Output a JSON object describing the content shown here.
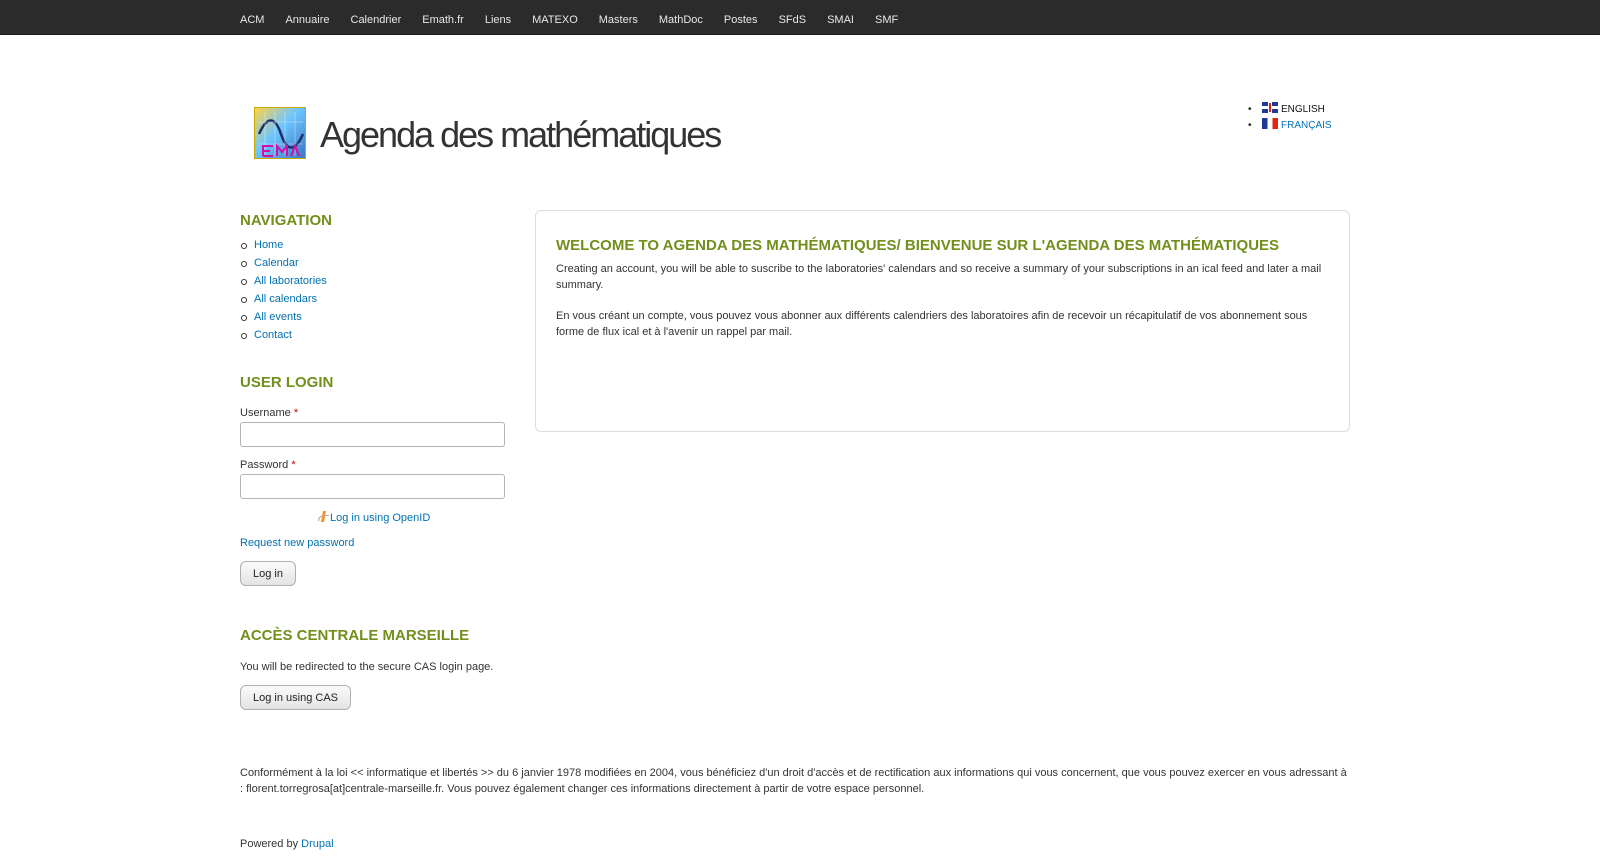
{
  "topnav": [
    "ACM",
    "Annuaire",
    "Calendrier",
    "Emath.fr",
    "Liens",
    "MATEXO",
    "Masters",
    "MathDoc",
    "Postes",
    "SFdS",
    "SMAI",
    "SMF"
  ],
  "header": {
    "site_name": "Agenda des mathématiques",
    "logo_icon": "emath-logo-icon",
    "languages": [
      {
        "label": "English",
        "flag": "uk-flag-icon",
        "active": true
      },
      {
        "label": "Français",
        "flag": "fr-flag-icon",
        "active": false
      }
    ]
  },
  "sidebar": {
    "navigation": {
      "title": "Navigation",
      "items": [
        "Home",
        "Calendar",
        "All laboratories",
        "All calendars",
        "All events",
        "Contact"
      ]
    },
    "user_login": {
      "title": "User login",
      "username_label": "Username",
      "password_label": "Password",
      "required_mark": "*",
      "username_value": "",
      "password_value": "",
      "openid_link": "Log in using OpenID",
      "request_password": "Request new password",
      "login_button": "Log in"
    },
    "cas": {
      "title": "Accès Centrale Marseille",
      "text": "You will be redirected to the secure CAS login page.",
      "button": "Log in using CAS"
    }
  },
  "content": {
    "title": "Welcome to Agenda des mathématiques/ Bienvenue sur l'Agenda des mathématiques",
    "p1": "Creating an account, you will be able to suscribe to the laboratories' calendars and so receive a summary of your subscriptions in an ical feed and later a mail summary.",
    "p2": "En vous créant un compte, vous pouvez vous abonner aux différents calendriers des laboratoires afin de recevoir un récapitulatif de vos abonnement sous forme de flux ical et à l'avenir un rappel par mail."
  },
  "footer": {
    "legal": "Conformément à la loi << informatique et libertés >> du 6 janvier 1978 modifiées en 2004, vous bénéficiez d'un droit d'accès et de rectification aux informations qui vous concernent, que vous pouvez exercer en vous adressant à : florent.torregrosa[at]centrale-marseille.fr. Vous pouvez également changer ces informations directement à partir de votre espace personnel.",
    "powered_prefix": "Powered by",
    "powered_link": "Drupal"
  },
  "colors": {
    "accent": "#728f1c",
    "link": "#0071b3",
    "topbar": "#2b2b2b"
  }
}
